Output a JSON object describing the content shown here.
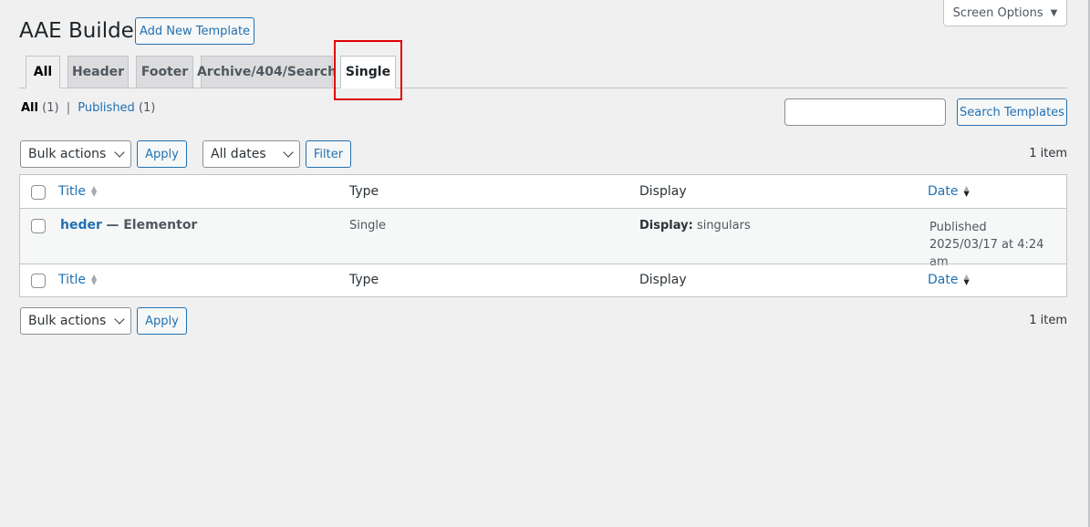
{
  "header": {
    "title": "AAE Builder",
    "add_new_label": "Add New Template",
    "screen_options_label": "Screen Options"
  },
  "tabs": [
    {
      "label": "All",
      "active": true
    },
    {
      "label": "Header"
    },
    {
      "label": "Footer"
    },
    {
      "label": "Archive/404/Search"
    },
    {
      "label": "Single",
      "highlighted": true
    }
  ],
  "views": {
    "all_label": "All",
    "all_count": "(1)",
    "separator": "|",
    "published_label": "Published",
    "published_count": "(1)"
  },
  "search": {
    "value": "",
    "button_label": "Search Templates"
  },
  "tablenav_top": {
    "bulk_actions": "Bulk actions",
    "apply_label": "Apply",
    "date_filter": "All dates",
    "filter_label": "Filter",
    "items_count": "1 item"
  },
  "table": {
    "columns": [
      "Title",
      "Type",
      "Display",
      "Date"
    ],
    "rows": [
      {
        "title": "heder",
        "title_suffix": "— Elementor",
        "type": "Single",
        "display_label": "Display:",
        "display_value": "singulars",
        "date_status": "Published",
        "date_value": "2025/03/17 at 4:24 am"
      }
    ]
  },
  "tablenav_bottom": {
    "bulk_actions": "Bulk actions",
    "apply_label": "Apply",
    "items_count": "1 item"
  },
  "colors": {
    "accent": "#2271b1",
    "highlight_box": "#e00000",
    "background": "#f0f0f1"
  }
}
